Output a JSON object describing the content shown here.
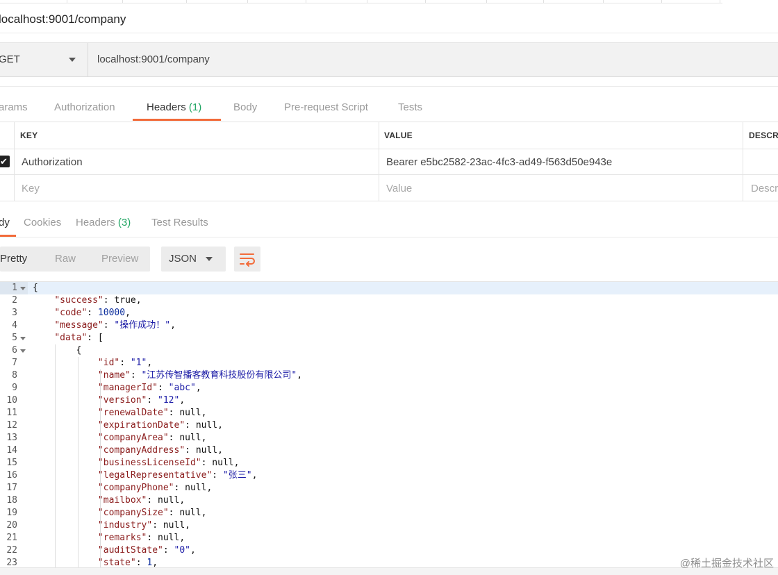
{
  "request": {
    "title": "localhost:9001/company",
    "method": "GET",
    "url": "localhost:9001/company"
  },
  "request_tabs": [
    {
      "label": "arams",
      "count": ""
    },
    {
      "label": "Authorization",
      "count": ""
    },
    {
      "label": "Headers",
      "count": "(1)"
    },
    {
      "label": "Body",
      "count": ""
    },
    {
      "label": "Pre-request Script",
      "count": ""
    },
    {
      "label": "Tests",
      "count": ""
    }
  ],
  "headers_table": {
    "columns": [
      "KEY",
      "VALUE",
      "DESCR"
    ],
    "rows": [
      {
        "checked": true,
        "key": "Authorization",
        "value": "Bearer e5bc2582-23ac-4fc3-ad49-f563d50e943e",
        "description": ""
      }
    ],
    "placeholders": {
      "key": "Key",
      "value": "Value",
      "description": "Descr"
    }
  },
  "response_tabs": [
    {
      "label": "dy",
      "count": ""
    },
    {
      "label": "Cookies",
      "count": ""
    },
    {
      "label": "Headers",
      "count": "(3)"
    },
    {
      "label": "Test Results",
      "count": ""
    }
  ],
  "view_modes": [
    "Pretty",
    "Raw",
    "Preview"
  ],
  "active_view_mode": "Pretty",
  "format": "JSON",
  "icons": {
    "wrap": "wrap-lines-icon",
    "checkbox": "checkmark-icon",
    "caret": "caret-down-icon"
  },
  "colors": {
    "accent": "#f26b3a",
    "count": "#20a563"
  },
  "code_lines": [
    [
      [
        "p",
        "{"
      ]
    ],
    [
      [
        "p",
        "    "
      ],
      [
        "k",
        "\"success\""
      ],
      [
        "p",
        ": "
      ],
      [
        "b",
        "true"
      ],
      [
        "p",
        ","
      ]
    ],
    [
      [
        "p",
        "    "
      ],
      [
        "k",
        "\"code\""
      ],
      [
        "p",
        ": "
      ],
      [
        "n",
        "10000"
      ],
      [
        "p",
        ","
      ]
    ],
    [
      [
        "p",
        "    "
      ],
      [
        "k",
        "\"message\""
      ],
      [
        "p",
        ": "
      ],
      [
        "s",
        "\"操作成功！\""
      ],
      [
        "p",
        ","
      ]
    ],
    [
      [
        "p",
        "    "
      ],
      [
        "k",
        "\"data\""
      ],
      [
        "p",
        ": ["
      ]
    ],
    [
      [
        "p",
        "        {"
      ]
    ],
    [
      [
        "p",
        "            "
      ],
      [
        "k",
        "\"id\""
      ],
      [
        "p",
        ": "
      ],
      [
        "s",
        "\"1\""
      ],
      [
        "p",
        ","
      ]
    ],
    [
      [
        "p",
        "            "
      ],
      [
        "k",
        "\"name\""
      ],
      [
        "p",
        ": "
      ],
      [
        "s",
        "\"江苏传智播客教育科技股份有限公司\""
      ],
      [
        "p",
        ","
      ]
    ],
    [
      [
        "p",
        "            "
      ],
      [
        "k",
        "\"managerId\""
      ],
      [
        "p",
        ": "
      ],
      [
        "s",
        "\"abc\""
      ],
      [
        "p",
        ","
      ]
    ],
    [
      [
        "p",
        "            "
      ],
      [
        "k",
        "\"version\""
      ],
      [
        "p",
        ": "
      ],
      [
        "s",
        "\"12\""
      ],
      [
        "p",
        ","
      ]
    ],
    [
      [
        "p",
        "            "
      ],
      [
        "k",
        "\"renewalDate\""
      ],
      [
        "p",
        ": "
      ],
      [
        "b",
        "null"
      ],
      [
        "p",
        ","
      ]
    ],
    [
      [
        "p",
        "            "
      ],
      [
        "k",
        "\"expirationDate\""
      ],
      [
        "p",
        ": "
      ],
      [
        "b",
        "null"
      ],
      [
        "p",
        ","
      ]
    ],
    [
      [
        "p",
        "            "
      ],
      [
        "k",
        "\"companyArea\""
      ],
      [
        "p",
        ": "
      ],
      [
        "b",
        "null"
      ],
      [
        "p",
        ","
      ]
    ],
    [
      [
        "p",
        "            "
      ],
      [
        "k",
        "\"companyAddress\""
      ],
      [
        "p",
        ": "
      ],
      [
        "b",
        "null"
      ],
      [
        "p",
        ","
      ]
    ],
    [
      [
        "p",
        "            "
      ],
      [
        "k",
        "\"businessLicenseId\""
      ],
      [
        "p",
        ": "
      ],
      [
        "b",
        "null"
      ],
      [
        "p",
        ","
      ]
    ],
    [
      [
        "p",
        "            "
      ],
      [
        "k",
        "\"legalRepresentative\""
      ],
      [
        "p",
        ": "
      ],
      [
        "s",
        "\"张三\""
      ],
      [
        "p",
        ","
      ]
    ],
    [
      [
        "p",
        "            "
      ],
      [
        "k",
        "\"companyPhone\""
      ],
      [
        "p",
        ": "
      ],
      [
        "b",
        "null"
      ],
      [
        "p",
        ","
      ]
    ],
    [
      [
        "p",
        "            "
      ],
      [
        "k",
        "\"mailbox\""
      ],
      [
        "p",
        ": "
      ],
      [
        "b",
        "null"
      ],
      [
        "p",
        ","
      ]
    ],
    [
      [
        "p",
        "            "
      ],
      [
        "k",
        "\"companySize\""
      ],
      [
        "p",
        ": "
      ],
      [
        "b",
        "null"
      ],
      [
        "p",
        ","
      ]
    ],
    [
      [
        "p",
        "            "
      ],
      [
        "k",
        "\"industry\""
      ],
      [
        "p",
        ": "
      ],
      [
        "b",
        "null"
      ],
      [
        "p",
        ","
      ]
    ],
    [
      [
        "p",
        "            "
      ],
      [
        "k",
        "\"remarks\""
      ],
      [
        "p",
        ": "
      ],
      [
        "b",
        "null"
      ],
      [
        "p",
        ","
      ]
    ],
    [
      [
        "p",
        "            "
      ],
      [
        "k",
        "\"auditState\""
      ],
      [
        "p",
        ": "
      ],
      [
        "s",
        "\"0\""
      ],
      [
        "p",
        ","
      ]
    ],
    [
      [
        "p",
        "            "
      ],
      [
        "k",
        "\"state\""
      ],
      [
        "p",
        ": "
      ],
      [
        "n",
        "1"
      ],
      [
        "p",
        ","
      ]
    ]
  ],
  "fold_lines": [
    1,
    5,
    6
  ],
  "watermark": "@稀土掘金技术社区"
}
